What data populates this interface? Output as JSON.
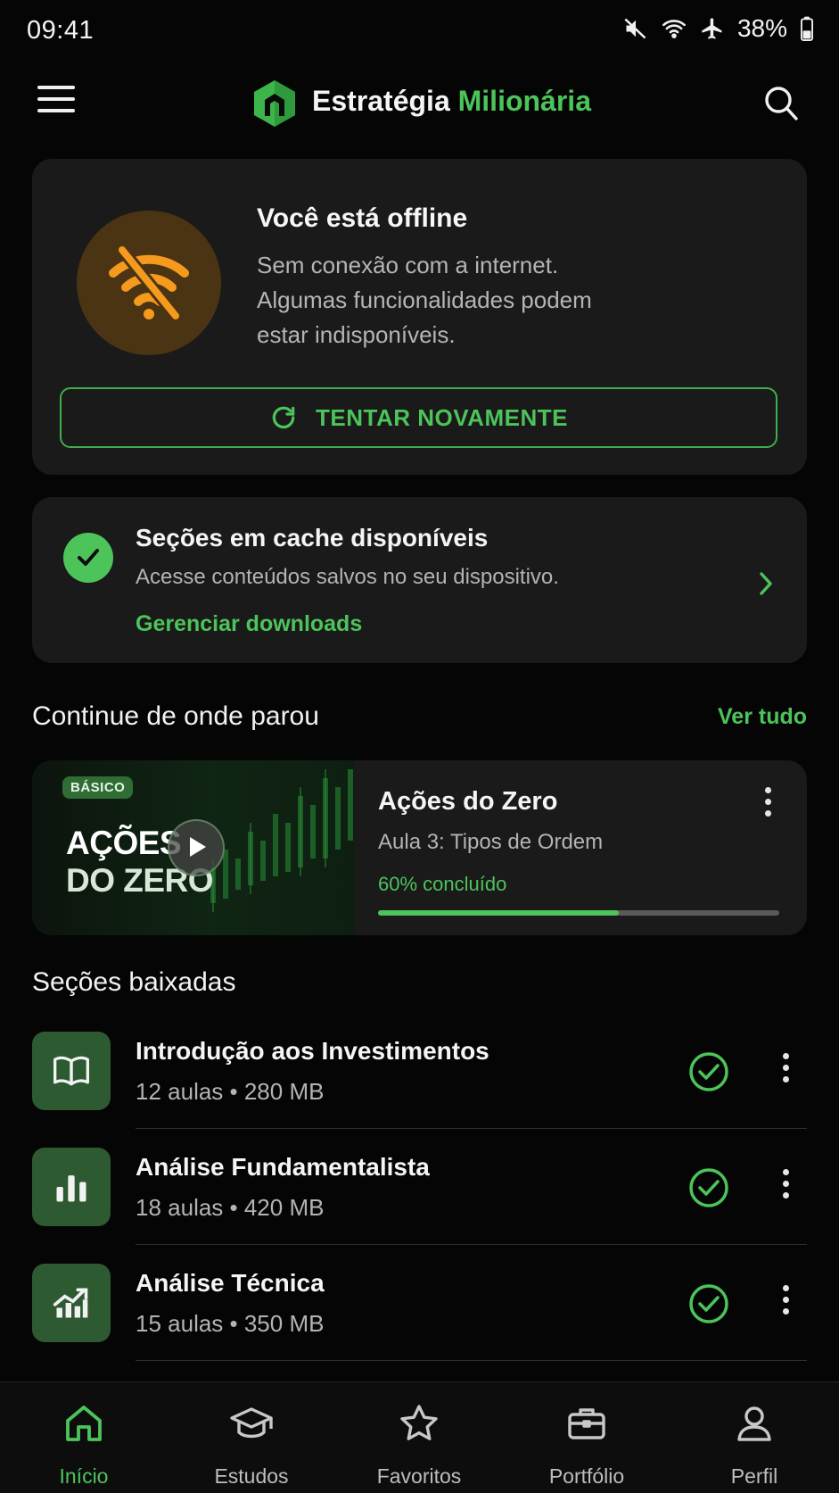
{
  "status_bar": {
    "time": "09:41",
    "battery": "38%",
    "icons": [
      "mute-icon",
      "wifi-icon",
      "airplane-icon",
      "battery-icon"
    ]
  },
  "header": {
    "brand_part1": "Estratégia",
    "brand_part2": "Milionária",
    "menu_icon": "hamburger-icon",
    "search_icon": "search-icon"
  },
  "offline": {
    "title": "Você está offline",
    "message": "Sem conexão com a internet. Algumas funcionalidades podem estar indisponíveis.",
    "retry_label": "TENTAR NOVAMENTE",
    "icon": "wifi-off-icon"
  },
  "cache": {
    "title": "Seções em cache disponíveis",
    "description": "Acesse conteúdos salvos no seu dispositivo.",
    "link": "Gerenciar downloads"
  },
  "continue": {
    "section_title": "Continue de onde parou",
    "see_all": "Ver tudo",
    "course": {
      "badge": "BÁSICO",
      "thumb_line1": "AÇÕES",
      "thumb_line2": "DO ZERO",
      "name": "Ações do Zero",
      "lesson": "Aula 3: Tipos de Ordem",
      "progress_label": "60% concluído",
      "progress": 0.6
    }
  },
  "downloads": {
    "section_title": "Seções baixadas",
    "items": [
      {
        "name": "Introdução aos Investimentos",
        "meta": "12 aulas • 280 MB",
        "icon": "book-icon"
      },
      {
        "name": "Análise Fundamentalista",
        "meta": "18 aulas • 420 MB",
        "icon": "bar-chart-icon"
      },
      {
        "name": "Análise Técnica",
        "meta": "15 aulas • 350 MB",
        "icon": "trend-chart-icon"
      }
    ]
  },
  "nav": {
    "items": [
      {
        "label": "Início",
        "icon": "home-icon",
        "active": true
      },
      {
        "label": "Estudos",
        "icon": "graduation-cap-icon",
        "active": false
      },
      {
        "label": "Favoritos",
        "icon": "star-icon",
        "active": false
      },
      {
        "label": "Portfólio",
        "icon": "briefcase-icon",
        "active": false
      },
      {
        "label": "Perfil",
        "icon": "person-icon",
        "active": false
      }
    ]
  },
  "colors": {
    "accent": "#4cc45a",
    "card": "#1a1a1a",
    "warning": "#f59a1c"
  }
}
